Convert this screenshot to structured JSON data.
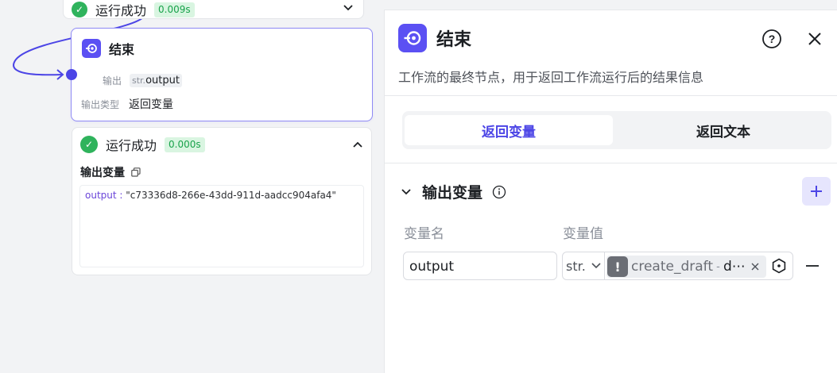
{
  "canvas": {
    "top_node": {
      "status": "运行成功",
      "time": "0.009s"
    },
    "end_node": {
      "title": "结束",
      "output_label": "输出",
      "output_type_badge": "str.",
      "output_name": "output",
      "output_type_label": "输出类型",
      "output_type_value": "返回变量"
    },
    "result_node": {
      "status": "运行成功",
      "time": "0.000s",
      "section_title": "输出变量",
      "output_key": "output : ",
      "output_value": "\"c73336d8-266e-43dd-911d-aadcc904afa4\""
    }
  },
  "panel": {
    "title": "结束",
    "description": "工作流的最终节点，用于返回工作流运行后的结果信息",
    "tabs": [
      {
        "label": "返回变量",
        "active": true
      },
      {
        "label": "返回文本",
        "active": false
      }
    ],
    "section_title": "输出变量",
    "col_name": "变量名",
    "col_value": "变量值",
    "row": {
      "name": "output",
      "type": "str.",
      "ref_source": "create_draft",
      "ref_sep": " - ",
      "ref_var": "d⋯"
    },
    "colors": {
      "accent": "#4c45e6",
      "success": "#2fb35c"
    }
  }
}
